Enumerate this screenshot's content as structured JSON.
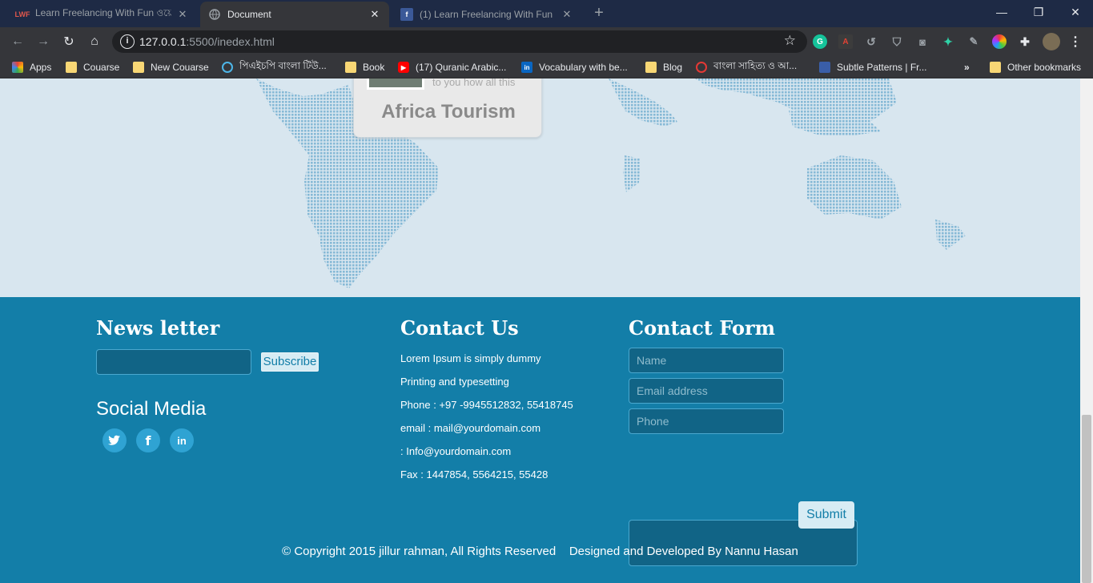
{
  "browser": {
    "tabs": [
      {
        "title": "Learn Freelancing With Fun ওয়ে",
        "favicon": "LWF"
      },
      {
        "title": "Document",
        "favicon": "globe-icon"
      },
      {
        "title": "(1) Learn Freelancing With Fun",
        "favicon": "f"
      }
    ],
    "url_host": "127.0.0.1",
    "url_rest": ":5500/inedex.html",
    "bookmarks": [
      {
        "label": "Apps",
        "icon": "apps-grid-icon"
      },
      {
        "label": "Couarse",
        "icon": "folder-icon"
      },
      {
        "label": "New Couarse",
        "icon": "folder-icon"
      },
      {
        "label": "পিএইচপি বাংলা টিউ...",
        "icon": "target-icon"
      },
      {
        "label": "Book",
        "icon": "folder-icon"
      },
      {
        "label": "(17) Quranic Arabic...",
        "icon": "youtube-icon"
      },
      {
        "label": "Vocabulary with be...",
        "icon": "linkedin-icon"
      },
      {
        "label": "Blog",
        "icon": "folder-icon"
      },
      {
        "label": "বাংলা সাহিত্য ও আ...",
        "icon": "red-logo-icon"
      },
      {
        "label": "Subtle Patterns | Fr...",
        "icon": "pattern-icon"
      },
      {
        "label": "»",
        "icon": "chevron-icon"
      },
      {
        "label": "Other bookmarks",
        "icon": "folder-icon"
      }
    ]
  },
  "map": {
    "callout_subtitle": "to you how all this",
    "callout_title": "Africa Tourism"
  },
  "footer": {
    "newsletter_heading": "News letter",
    "subscribe_label": "Subscribe",
    "social_heading": "Social Media",
    "social": [
      "twitter-icon",
      "facebook-icon",
      "linkedin-icon"
    ],
    "contact_heading": "Contact Us",
    "contact_lines": [
      "Lorem Ipsum is simply dummy",
      "Printing and typesetting",
      "Phone : +97 -9945512832, 55418745",
      "email : mail@yourdomain.com",
      ": Info@yourdomain.com",
      "Fax : 1447854, 5564215, 55428"
    ],
    "form_heading": "Contact Form",
    "name_placeholder": "Name",
    "email_placeholder": "Email address",
    "phone_placeholder": "Phone",
    "submit_label": "Submit",
    "copyright": "© Copyright 2015 jillur rahman, All Rights Reserved    Designed and Developed By Nannu Hasan"
  }
}
